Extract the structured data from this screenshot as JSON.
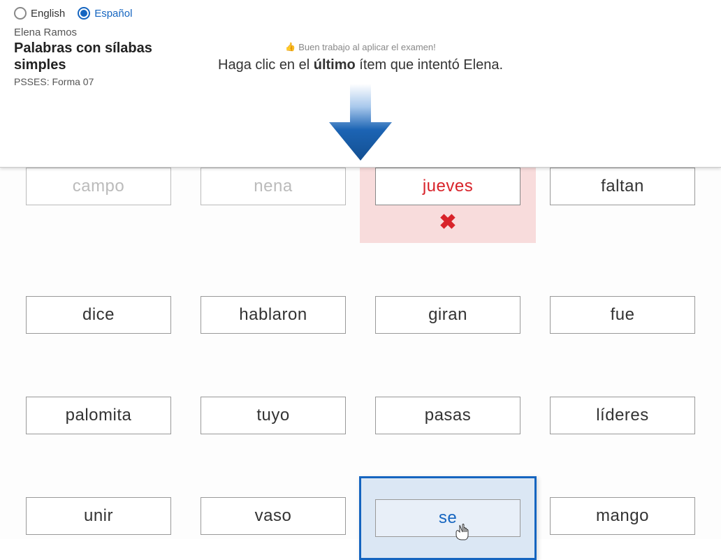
{
  "lang": {
    "english": "English",
    "espanol": "Español",
    "selected": "espanol"
  },
  "student": "Elena Ramos",
  "test_title": "Palabras con sílabas simples",
  "test_form": "PSSES: Forma 07",
  "praise": "Buen trabajo al aplicar el examen!",
  "instruction_pre": "Haga clic en el ",
  "instruction_bold": "último",
  "instruction_post": " ítem que intentó Elena.",
  "words": [
    {
      "text": "campo",
      "state": "faded"
    },
    {
      "text": "nena",
      "state": "faded"
    },
    {
      "text": "jueves",
      "state": "error"
    },
    {
      "text": "faltan",
      "state": "normal"
    },
    {
      "text": "dice",
      "state": "normal"
    },
    {
      "text": "hablaron",
      "state": "normal"
    },
    {
      "text": "giran",
      "state": "normal"
    },
    {
      "text": "fue",
      "state": "normal"
    },
    {
      "text": "palomita",
      "state": "normal"
    },
    {
      "text": "tuyo",
      "state": "normal"
    },
    {
      "text": "pasas",
      "state": "normal"
    },
    {
      "text": "líderes",
      "state": "normal"
    },
    {
      "text": "unir",
      "state": "normal"
    },
    {
      "text": "vaso",
      "state": "normal"
    },
    {
      "text": "se",
      "state": "selected"
    },
    {
      "text": "mango",
      "state": "normal"
    }
  ]
}
